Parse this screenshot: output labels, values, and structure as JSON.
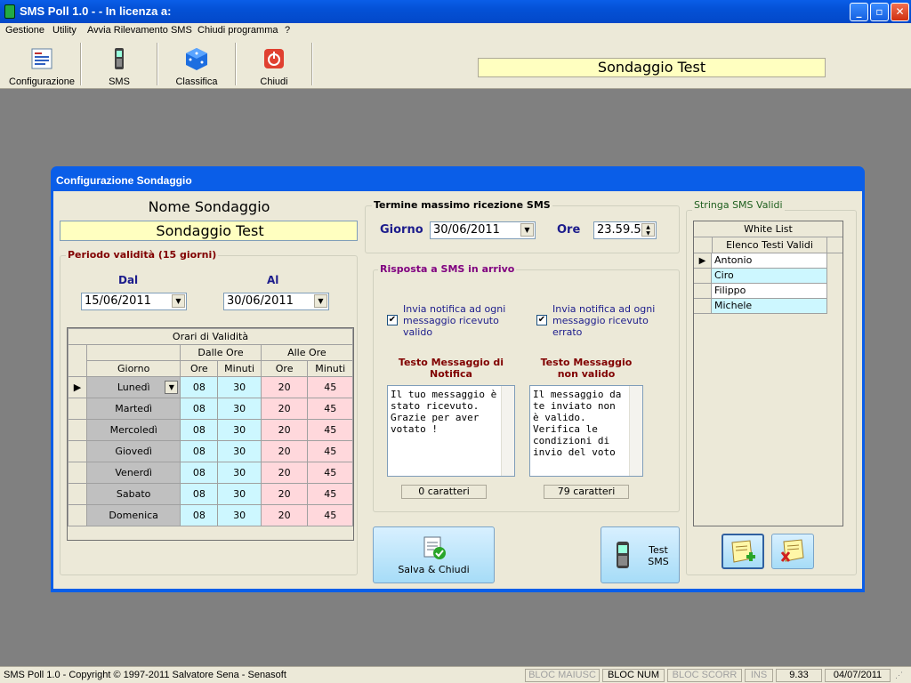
{
  "window": {
    "title": "SMS Poll 1.0 - - In licenza a:"
  },
  "menu": [
    "Gestione",
    "Utility",
    "Avvia Rilevamento SMS",
    "Chiudi programma",
    "?"
  ],
  "toolbar": {
    "buttons": [
      "Configurazione",
      "SMS",
      "Classifica",
      "Chiudi"
    ],
    "poll_name": "Sondaggio Test"
  },
  "dialog": {
    "title": "Configurazione Sondaggio",
    "name_label": "Nome Sondaggio",
    "name_value": "Sondaggio Test",
    "period": {
      "label": "Periodo validità (15 giorni)",
      "from_label": "Dal",
      "from_value": "15/06/2011",
      "to_label": "Al",
      "to_value": "30/06/2011"
    },
    "hours_table": {
      "title": "Orari di Validità",
      "group_from": "Dalle Ore",
      "group_to": "Alle Ore",
      "col_day": "Giorno",
      "col_hour": "Ore",
      "col_min": "Minuti",
      "rows": [
        {
          "day": "Lunedì",
          "h1": "08",
          "m1": "30",
          "h2": "20",
          "m2": "45"
        },
        {
          "day": "Martedì",
          "h1": "08",
          "m1": "30",
          "h2": "20",
          "m2": "45"
        },
        {
          "day": "Mercoledì",
          "h1": "08",
          "m1": "30",
          "h2": "20",
          "m2": "45"
        },
        {
          "day": "Giovedì",
          "h1": "08",
          "m1": "30",
          "h2": "20",
          "m2": "45"
        },
        {
          "day": "Venerdì",
          "h1": "08",
          "m1": "30",
          "h2": "20",
          "m2": "45"
        },
        {
          "day": "Sabato",
          "h1": "08",
          "m1": "30",
          "h2": "20",
          "m2": "45"
        },
        {
          "day": "Domenica",
          "h1": "08",
          "m1": "30",
          "h2": "20",
          "m2": "45"
        }
      ]
    },
    "deadline": {
      "label": "Termine massimo ricezione SMS",
      "day_label": "Giorno",
      "day_value": "30/06/2011",
      "hour_label": "Ore",
      "hour_value": "23.59.5"
    },
    "reply": {
      "label": "Risposta a SMS in arrivo",
      "notify_valid": "Invia notifica ad ogni messaggio ricevuto valido",
      "notify_invalid": "Invia notifica ad ogni messaggio ricevuto errato",
      "msg_valid_title": "Testo Messaggio di Notifica",
      "msg_invalid_title": "Testo Messaggio non valido",
      "msg_valid_text": "Il tuo messaggio è stato ricevuto. Grazie per aver votato !",
      "msg_invalid_text": "Il messaggio da te inviato non è valido. Verifica le condizioni di invio del voto",
      "count_valid": "0 caratteri",
      "count_invalid": "79 caratteri"
    },
    "buttons": {
      "save": "Salva & Chiudi",
      "test": "Test SMS"
    },
    "whitelist": {
      "group_label": "Stringa SMS Validi",
      "title": "White List",
      "col": "Elenco Testi Validi",
      "items": [
        "Antonio",
        "Ciro",
        "Filippo",
        "Michele"
      ]
    }
  },
  "status": {
    "copyright": "SMS Poll 1.0 - Copyright © 1997-2011 Salvatore Sena - Senasoft",
    "caps": "BLOC MAIUSC",
    "num": "BLOC NUM",
    "scroll": "BLOC SCORR",
    "ins": "INS",
    "time": "9.33",
    "date": "04/07/2011"
  }
}
